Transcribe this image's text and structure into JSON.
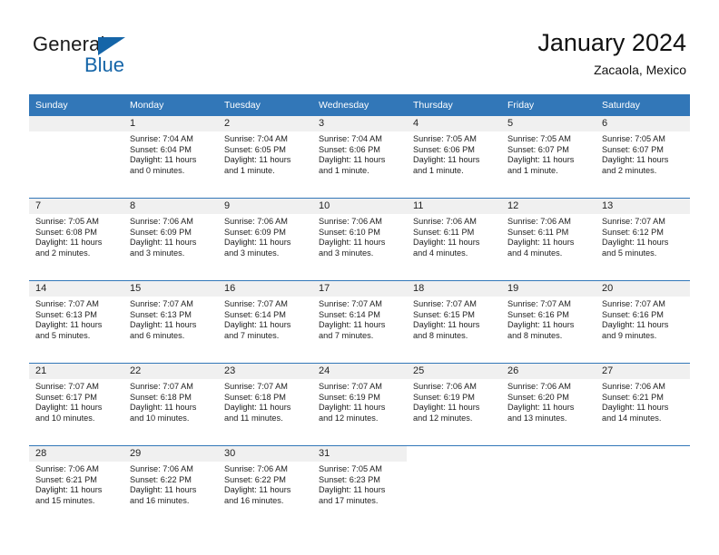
{
  "brand": {
    "word_one": "General",
    "word_two": "Blue",
    "flag_icon": "triangle-flag-icon",
    "accent_color": "#1565a8"
  },
  "header": {
    "title": "January 2024",
    "subtitle": "Zacaola, Mexico"
  },
  "calendar": {
    "header_background": "#3277b8",
    "daynum_background": "#f0f0f0",
    "weekday_headers": [
      "Sunday",
      "Monday",
      "Tuesday",
      "Wednesday",
      "Thursday",
      "Friday",
      "Saturday"
    ],
    "weeks": [
      [
        {
          "day": "",
          "empty": true
        },
        {
          "day": "1",
          "sunrise": "Sunrise: 7:04 AM",
          "sunset": "Sunset: 6:04 PM",
          "daylight_1": "Daylight: 11 hours",
          "daylight_2": "and 0 minutes."
        },
        {
          "day": "2",
          "sunrise": "Sunrise: 7:04 AM",
          "sunset": "Sunset: 6:05 PM",
          "daylight_1": "Daylight: 11 hours",
          "daylight_2": "and 1 minute."
        },
        {
          "day": "3",
          "sunrise": "Sunrise: 7:04 AM",
          "sunset": "Sunset: 6:06 PM",
          "daylight_1": "Daylight: 11 hours",
          "daylight_2": "and 1 minute."
        },
        {
          "day": "4",
          "sunrise": "Sunrise: 7:05 AM",
          "sunset": "Sunset: 6:06 PM",
          "daylight_1": "Daylight: 11 hours",
          "daylight_2": "and 1 minute."
        },
        {
          "day": "5",
          "sunrise": "Sunrise: 7:05 AM",
          "sunset": "Sunset: 6:07 PM",
          "daylight_1": "Daylight: 11 hours",
          "daylight_2": "and 1 minute."
        },
        {
          "day": "6",
          "sunrise": "Sunrise: 7:05 AM",
          "sunset": "Sunset: 6:07 PM",
          "daylight_1": "Daylight: 11 hours",
          "daylight_2": "and 2 minutes."
        }
      ],
      [
        {
          "day": "7",
          "sunrise": "Sunrise: 7:05 AM",
          "sunset": "Sunset: 6:08 PM",
          "daylight_1": "Daylight: 11 hours",
          "daylight_2": "and 2 minutes."
        },
        {
          "day": "8",
          "sunrise": "Sunrise: 7:06 AM",
          "sunset": "Sunset: 6:09 PM",
          "daylight_1": "Daylight: 11 hours",
          "daylight_2": "and 3 minutes."
        },
        {
          "day": "9",
          "sunrise": "Sunrise: 7:06 AM",
          "sunset": "Sunset: 6:09 PM",
          "daylight_1": "Daylight: 11 hours",
          "daylight_2": "and 3 minutes."
        },
        {
          "day": "10",
          "sunrise": "Sunrise: 7:06 AM",
          "sunset": "Sunset: 6:10 PM",
          "daylight_1": "Daylight: 11 hours",
          "daylight_2": "and 3 minutes."
        },
        {
          "day": "11",
          "sunrise": "Sunrise: 7:06 AM",
          "sunset": "Sunset: 6:11 PM",
          "daylight_1": "Daylight: 11 hours",
          "daylight_2": "and 4 minutes."
        },
        {
          "day": "12",
          "sunrise": "Sunrise: 7:06 AM",
          "sunset": "Sunset: 6:11 PM",
          "daylight_1": "Daylight: 11 hours",
          "daylight_2": "and 4 minutes."
        },
        {
          "day": "13",
          "sunrise": "Sunrise: 7:07 AM",
          "sunset": "Sunset: 6:12 PM",
          "daylight_1": "Daylight: 11 hours",
          "daylight_2": "and 5 minutes."
        }
      ],
      [
        {
          "day": "14",
          "sunrise": "Sunrise: 7:07 AM",
          "sunset": "Sunset: 6:13 PM",
          "daylight_1": "Daylight: 11 hours",
          "daylight_2": "and 5 minutes."
        },
        {
          "day": "15",
          "sunrise": "Sunrise: 7:07 AM",
          "sunset": "Sunset: 6:13 PM",
          "daylight_1": "Daylight: 11 hours",
          "daylight_2": "and 6 minutes."
        },
        {
          "day": "16",
          "sunrise": "Sunrise: 7:07 AM",
          "sunset": "Sunset: 6:14 PM",
          "daylight_1": "Daylight: 11 hours",
          "daylight_2": "and 7 minutes."
        },
        {
          "day": "17",
          "sunrise": "Sunrise: 7:07 AM",
          "sunset": "Sunset: 6:14 PM",
          "daylight_1": "Daylight: 11 hours",
          "daylight_2": "and 7 minutes."
        },
        {
          "day": "18",
          "sunrise": "Sunrise: 7:07 AM",
          "sunset": "Sunset: 6:15 PM",
          "daylight_1": "Daylight: 11 hours",
          "daylight_2": "and 8 minutes."
        },
        {
          "day": "19",
          "sunrise": "Sunrise: 7:07 AM",
          "sunset": "Sunset: 6:16 PM",
          "daylight_1": "Daylight: 11 hours",
          "daylight_2": "and 8 minutes."
        },
        {
          "day": "20",
          "sunrise": "Sunrise: 7:07 AM",
          "sunset": "Sunset: 6:16 PM",
          "daylight_1": "Daylight: 11 hours",
          "daylight_2": "and 9 minutes."
        }
      ],
      [
        {
          "day": "21",
          "sunrise": "Sunrise: 7:07 AM",
          "sunset": "Sunset: 6:17 PM",
          "daylight_1": "Daylight: 11 hours",
          "daylight_2": "and 10 minutes."
        },
        {
          "day": "22",
          "sunrise": "Sunrise: 7:07 AM",
          "sunset": "Sunset: 6:18 PM",
          "daylight_1": "Daylight: 11 hours",
          "daylight_2": "and 10 minutes."
        },
        {
          "day": "23",
          "sunrise": "Sunrise: 7:07 AM",
          "sunset": "Sunset: 6:18 PM",
          "daylight_1": "Daylight: 11 hours",
          "daylight_2": "and 11 minutes."
        },
        {
          "day": "24",
          "sunrise": "Sunrise: 7:07 AM",
          "sunset": "Sunset: 6:19 PM",
          "daylight_1": "Daylight: 11 hours",
          "daylight_2": "and 12 minutes."
        },
        {
          "day": "25",
          "sunrise": "Sunrise: 7:06 AM",
          "sunset": "Sunset: 6:19 PM",
          "daylight_1": "Daylight: 11 hours",
          "daylight_2": "and 12 minutes."
        },
        {
          "day": "26",
          "sunrise": "Sunrise: 7:06 AM",
          "sunset": "Sunset: 6:20 PM",
          "daylight_1": "Daylight: 11 hours",
          "daylight_2": "and 13 minutes."
        },
        {
          "day": "27",
          "sunrise": "Sunrise: 7:06 AM",
          "sunset": "Sunset: 6:21 PM",
          "daylight_1": "Daylight: 11 hours",
          "daylight_2": "and 14 minutes."
        }
      ],
      [
        {
          "day": "28",
          "sunrise": "Sunrise: 7:06 AM",
          "sunset": "Sunset: 6:21 PM",
          "daylight_1": "Daylight: 11 hours",
          "daylight_2": "and 15 minutes."
        },
        {
          "day": "29",
          "sunrise": "Sunrise: 7:06 AM",
          "sunset": "Sunset: 6:22 PM",
          "daylight_1": "Daylight: 11 hours",
          "daylight_2": "and 16 minutes."
        },
        {
          "day": "30",
          "sunrise": "Sunrise: 7:06 AM",
          "sunset": "Sunset: 6:22 PM",
          "daylight_1": "Daylight: 11 hours",
          "daylight_2": "and 16 minutes."
        },
        {
          "day": "31",
          "sunrise": "Sunrise: 7:05 AM",
          "sunset": "Sunset: 6:23 PM",
          "daylight_1": "Daylight: 11 hours",
          "daylight_2": "and 17 minutes."
        },
        {
          "day": "",
          "empty": true,
          "blank": true
        },
        {
          "day": "",
          "empty": true,
          "blank": true
        },
        {
          "day": "",
          "empty": true,
          "blank": true
        }
      ]
    ]
  }
}
